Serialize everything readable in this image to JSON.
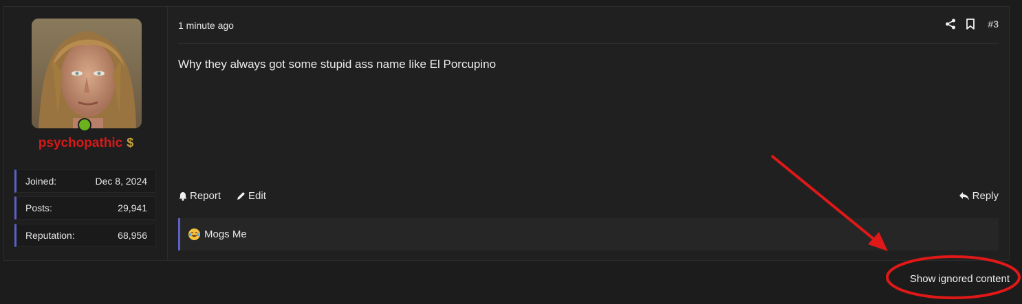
{
  "post": {
    "user": {
      "name": "psychopathic",
      "badge_icon": "dollar-icon",
      "online": true,
      "stats": [
        {
          "label": "Joined:",
          "value": "Dec 8, 2024"
        },
        {
          "label": "Posts:",
          "value": "29,941"
        },
        {
          "label": "Reputation:",
          "value": "68,956"
        }
      ]
    },
    "timestamp": "1 minute ago",
    "post_number": "#3",
    "message": "Why they always got some stupid ass name like El Porcupino",
    "actions": {
      "report": "Report",
      "edit": "Edit",
      "reply": "Reply"
    },
    "reaction": {
      "icon": "tears-of-joy-icon",
      "label": "Mogs Me"
    }
  },
  "show_ignored": "Show ignored content",
  "colors": {
    "accent": "#5b61c9",
    "username": "#d61a1a",
    "online": "#6cb21f",
    "annotation": "#e01818"
  }
}
